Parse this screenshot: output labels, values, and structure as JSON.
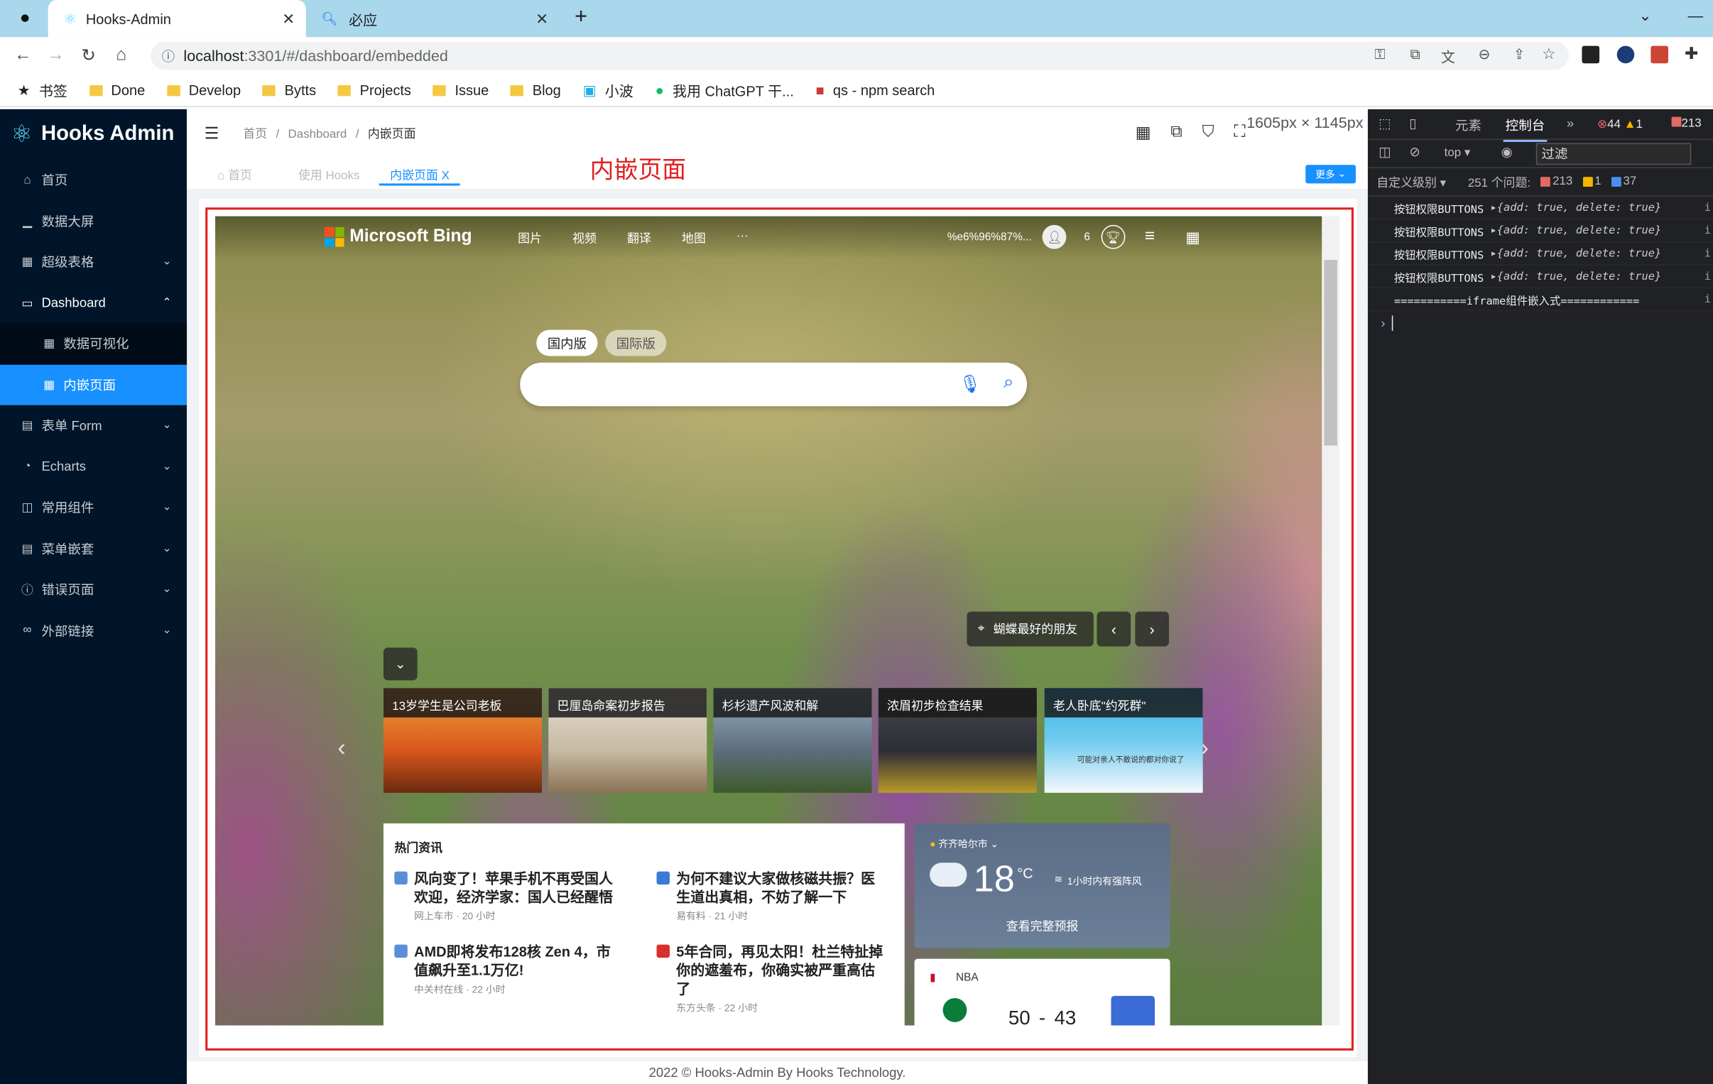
{
  "browser": {
    "tabs": [
      {
        "title": "Hooks-Admin",
        "close": "✕"
      },
      {
        "title": "必应",
        "close": "✕"
      }
    ],
    "new_tab": "+",
    "url_host": "localhost",
    "url_path": ":3301/#/dashboard/embedded",
    "bookmarks": [
      {
        "label": "书签",
        "icon": "star-icon"
      },
      {
        "label": "Done",
        "icon": "folder-icon"
      },
      {
        "label": "Develop",
        "icon": "folder-icon"
      },
      {
        "label": "Bytts",
        "icon": "folder-icon"
      },
      {
        "label": "Projects",
        "icon": "folder-icon"
      },
      {
        "label": "Issue",
        "icon": "folder-icon"
      },
      {
        "label": "Blog",
        "icon": "folder-icon"
      },
      {
        "label": "小波",
        "icon": "bilibili-icon"
      },
      {
        "label": "我用 ChatGPT 干...",
        "icon": "wechat-icon"
      },
      {
        "label": "qs - npm search",
        "icon": "npm-icon"
      }
    ],
    "size_tooltip": "1605px × 1145px"
  },
  "app": {
    "logo_text": "Hooks Admin",
    "menu": [
      {
        "label": "首页",
        "icon": "home-icon"
      },
      {
        "label": "数据大屏",
        "icon": "chart-icon"
      },
      {
        "label": "超级表格",
        "icon": "table-icon",
        "arrow": "⌄"
      },
      {
        "label": "Dashboard",
        "icon": "dashboard-icon",
        "arrow": "⌃"
      },
      {
        "label": "数据可视化",
        "icon": "grid-icon"
      },
      {
        "label": "内嵌页面",
        "icon": "grid-icon"
      },
      {
        "label": "表单 Form",
        "icon": "form-icon",
        "arrow": "⌄"
      },
      {
        "label": "Echarts",
        "icon": "pie-icon",
        "arrow": "⌄"
      },
      {
        "label": "常用组件",
        "icon": "bag-icon",
        "arrow": "⌄"
      },
      {
        "label": "菜单嵌套",
        "icon": "menu-icon",
        "arrow": "⌄"
      },
      {
        "label": "错误页面",
        "icon": "warning-icon",
        "arrow": "⌄"
      },
      {
        "label": "外部链接",
        "icon": "link-icon",
        "arrow": "⌄"
      }
    ],
    "breadcrumb": {
      "home": "首页",
      "sep": "/",
      "parent": "Dashboard",
      "current": "内嵌页面"
    },
    "tabs": [
      {
        "label": "首页"
      },
      {
        "label": "使用 Hooks"
      },
      {
        "label": "内嵌页面",
        "close": "X"
      }
    ],
    "page_title": "内嵌页面",
    "more_button": "更多",
    "footer": "2022 © Hooks-Admin By Hooks Technology."
  },
  "bing": {
    "brand": "Microsoft Bing",
    "nav": [
      "图片",
      "视频",
      "翻译",
      "地图",
      "···"
    ],
    "user": "%e6%96%87%...",
    "points": "6",
    "scope_cn": "国内版",
    "scope_intl": "国际版",
    "image_caption": "蝴蝶最好的朋友",
    "news_cards": [
      "13岁学生是公司老板",
      "巴厘岛命案初步报告",
      "杉杉遗产风波和解",
      "浓眉初步检查结果",
      "老人卧底\"约死群\""
    ],
    "news_card_last_sub": "可能对亲人不敢说的都对你说了",
    "hot_title": "热门资讯",
    "hot_items": [
      {
        "title": "风向变了！苹果手机不再受国人欢迎，经济学家：国人已经醒悟",
        "source": "网上车市 · 20 小时"
      },
      {
        "title": "为何不建议大家做核磁共振？医生道出真相，不妨了解一下",
        "source": "易有料 · 21 小时"
      },
      {
        "title": "AMD即将发布128核 Zen 4，市值飙升至1.1万亿!",
        "source": "中关村在线 · 22 小时"
      },
      {
        "title": "5年合同，再见太阳！杜兰特扯掉你的遮羞布，你确实被严重高估了",
        "source": "东方头条 · 22 小时"
      }
    ],
    "weather": {
      "city": "齐齐哈尔市",
      "temp": "18",
      "unit": "°C",
      "alert": "1小时内有强阵风",
      "forecast": "查看完整预报"
    },
    "nba": {
      "label": "NBA",
      "score_home": "50",
      "score_sep": "-",
      "score_away": "43"
    }
  },
  "devtools": {
    "tabs": [
      "元素",
      "控制台"
    ],
    "more": "»",
    "counts_error": "44",
    "counts_warn": "1",
    "counts_issue": "213",
    "context": "top",
    "filter_placeholder": "过滤",
    "level": "自定义级别",
    "issues": "251 个问题:",
    "issue_red": "213",
    "issue_yellow": "1",
    "issue_blue": "37",
    "logs": [
      {
        "label": "按钮权限BUTTONS",
        "obj": "▸{add: true, delete: true}",
        "src": "i"
      },
      {
        "label": "按钮权限BUTTONS",
        "obj": "▸{add: true, delete: true}",
        "src": "i"
      },
      {
        "label": "按钮权限BUTTONS",
        "obj": "▸{add: true, delete: true}",
        "src": "i"
      },
      {
        "label": "按钮权限BUTTONS",
        "obj": "▸{add: true, delete: true}",
        "src": "i"
      },
      {
        "label": "===========iframe组件嵌入式============",
        "obj": "",
        "src": "i"
      }
    ],
    "prompt": "›"
  }
}
